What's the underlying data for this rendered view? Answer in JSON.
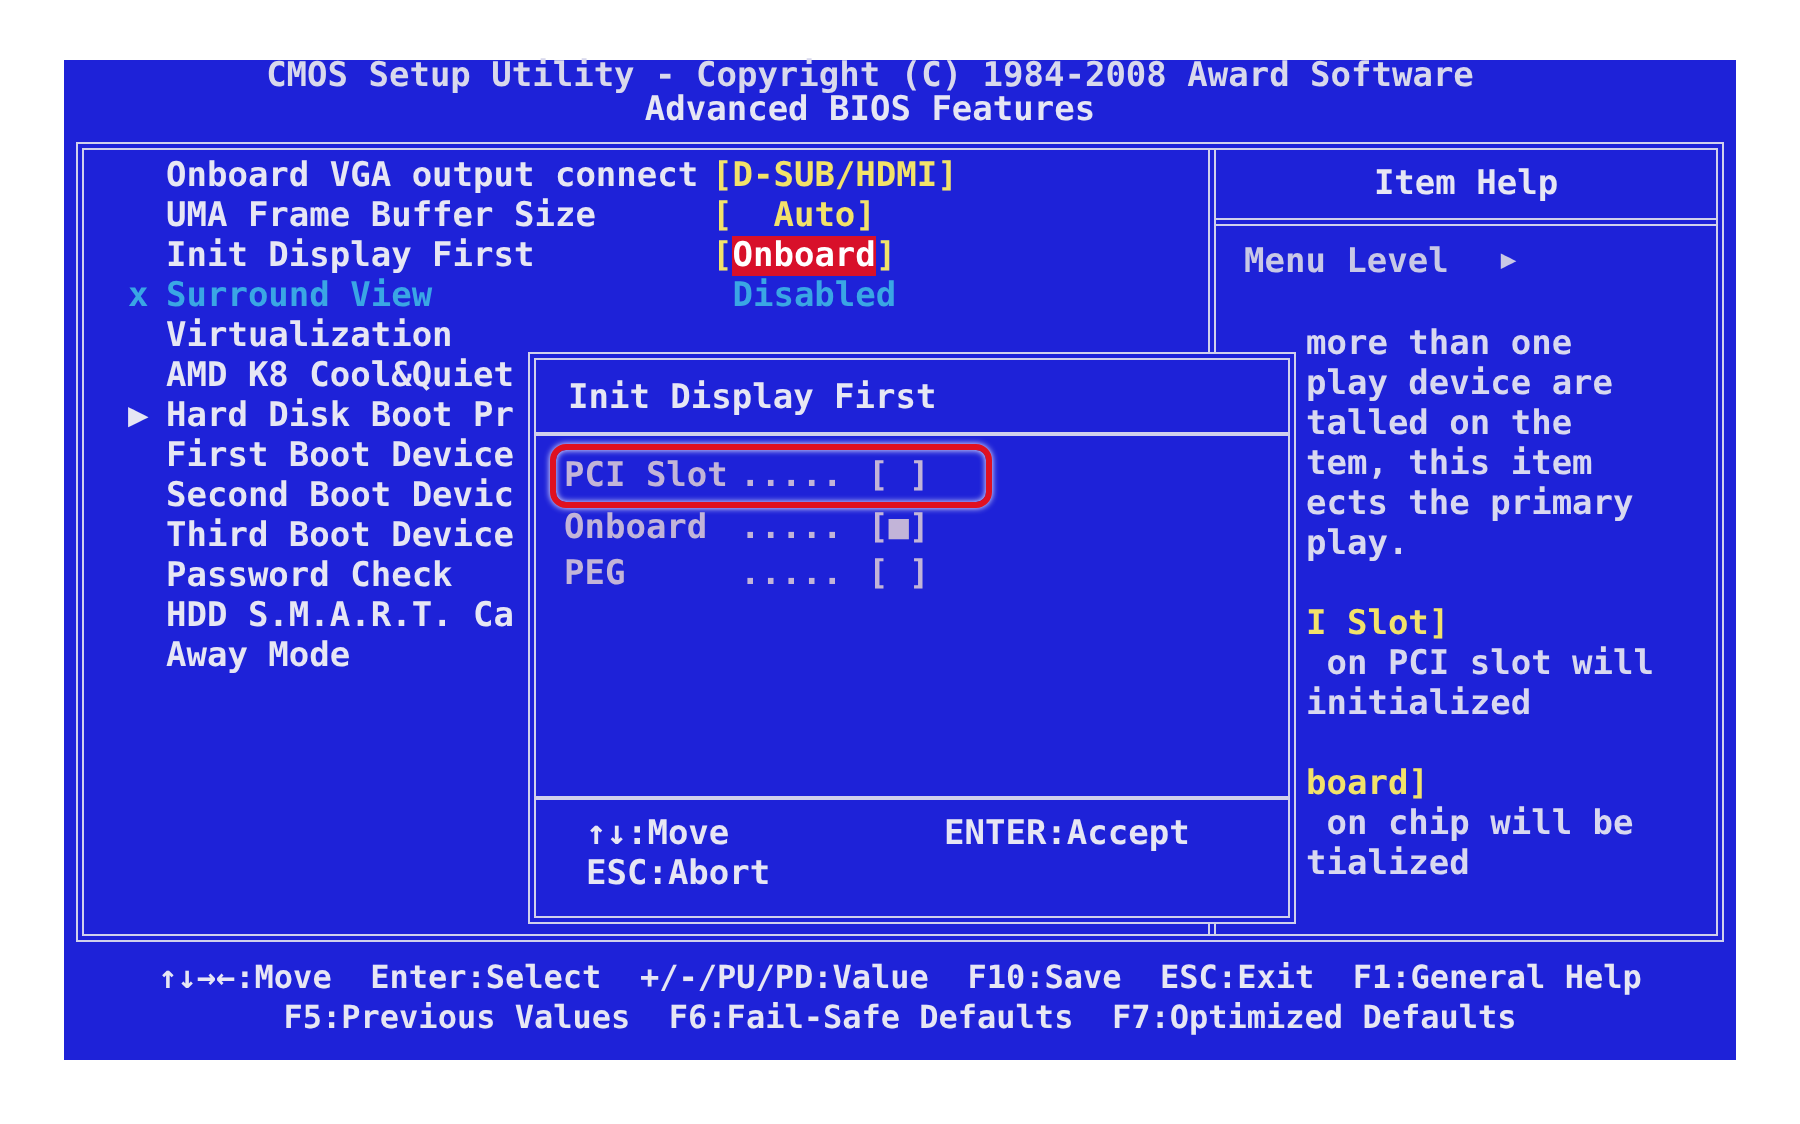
{
  "title": {
    "line_1": "CMOS Setup Utility - Copyright (C) 1984-2008 Award Software",
    "line_2": "Advanced BIOS Features"
  },
  "settings": [
    {
      "label": "Onboard VGA output connect",
      "value": "[D-SUB/HDMI]",
      "disabled": false,
      "selected": false
    },
    {
      "label": "UMA Frame Buffer Size",
      "value": "[  Auto]",
      "disabled": false,
      "selected": false
    },
    {
      "label": "Init Display First",
      "value": "[Onboard]",
      "disabled": false,
      "selected": true
    },
    {
      "marker": "x",
      "label": "Surround View",
      "value": " Disabled",
      "disabled": true,
      "selected": false
    },
    {
      "label": "Virtualization",
      "disabled": false
    },
    {
      "label": "AMD K8 Cool&Quiet",
      "disabled": false
    },
    {
      "marker": "▶",
      "label": "Hard Disk Boot Pr",
      "disabled": false
    },
    {
      "label": "First Boot Device",
      "disabled": false
    },
    {
      "label": "Second Boot Devic",
      "disabled": false
    },
    {
      "label": "Third Boot Device",
      "disabled": false
    },
    {
      "label": "Password Check",
      "disabled": false
    },
    {
      "label": "HDD S.M.A.R.T. Ca",
      "disabled": false
    },
    {
      "label": "Away Mode",
      "disabled": false
    }
  ],
  "help": {
    "title": "Item Help",
    "menu_level": "Menu Level",
    "menu_level_arrow": "▶",
    "paragraphs": [
      [
        {
          "text": "more than one",
          "kind": "text"
        },
        {
          "text": "play device are",
          "kind": "text"
        },
        {
          "text": "talled on the",
          "kind": "text"
        },
        {
          "text": "tem, this item",
          "kind": "text"
        },
        {
          "text": "ects the primary",
          "kind": "text"
        },
        {
          "text": "play.",
          "kind": "text"
        }
      ],
      [
        {
          "text": "I Slot]",
          "kind": "heading"
        },
        {
          "text": " on PCI slot will",
          "kind": "text"
        },
        {
          "text": "initialized",
          "kind": "text"
        }
      ],
      [
        {
          "text": "board]",
          "kind": "heading"
        },
        {
          "text": " on chip will be",
          "kind": "text"
        },
        {
          "text": "tialized",
          "kind": "text"
        }
      ]
    ]
  },
  "popup": {
    "title": "Init Display First",
    "options": [
      {
        "label": "PCI Slot",
        "leader": ".....",
        "box": "[ ]",
        "selected": true
      },
      {
        "label": "Onboard",
        "leader": ".....",
        "box": "[■]",
        "selected": false
      },
      {
        "label": "PEG",
        "leader": ".....",
        "box": "[ ]",
        "selected": false
      }
    ],
    "keys": {
      "move": "↑↓:Move",
      "accept": "ENTER:Accept",
      "abort": "ESC:Abort"
    }
  },
  "footer": {
    "line_1": "↑↓→←:Move  Enter:Select  +/-/PU/PD:Value  F10:Save  ESC:Exit  F1:General Help",
    "line_2": "F5:Previous Values  F6:Fail-Safe Defaults  F7:Optimized Defaults"
  }
}
